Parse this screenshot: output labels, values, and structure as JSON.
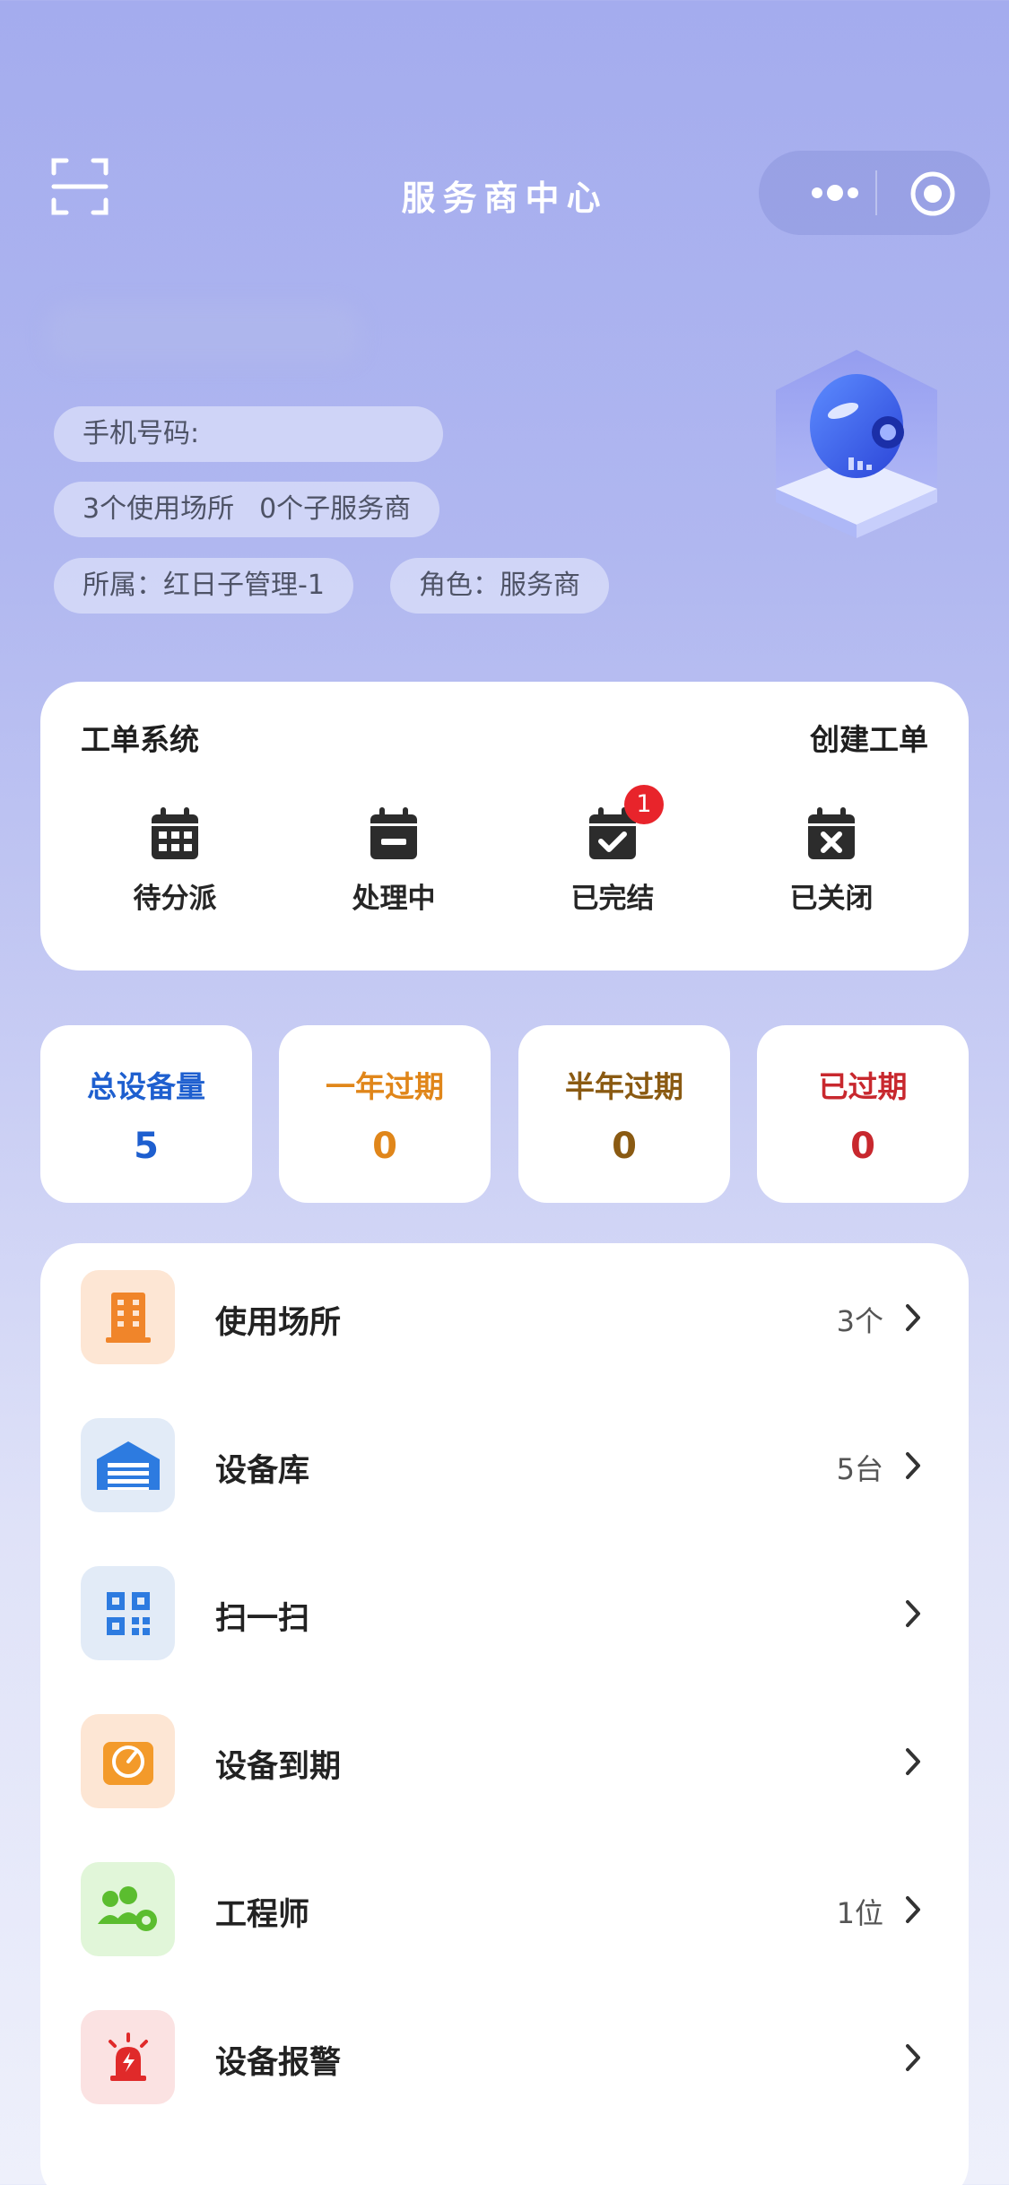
{
  "header": {
    "title": "服务商中心"
  },
  "profile": {
    "phone_label": "手机号码:",
    "venues_count": "3个使用场所",
    "sub_providers_count": "0个子服务商",
    "owner": "所属：红日子管理-1",
    "role": "角色：服务商"
  },
  "work_orders": {
    "title": "工单系统",
    "create_label": "创建工单",
    "items": [
      {
        "label": "待分派"
      },
      {
        "label": "处理中"
      },
      {
        "label": "已完结",
        "badge": "1"
      },
      {
        "label": "已关闭"
      }
    ]
  },
  "stats": [
    {
      "title": "总设备量",
      "value": "5",
      "color": "#1e5fcf"
    },
    {
      "title": "一年过期",
      "value": "0",
      "color": "#e0861a"
    },
    {
      "title": "半年过期",
      "value": "0",
      "color": "#8a5a12"
    },
    {
      "title": "已过期",
      "value": "0",
      "color": "#c8282e"
    }
  ],
  "menu": [
    {
      "name": "使用场所",
      "value": "3个",
      "icon": "building-icon",
      "icon_bg": "#fde6d4",
      "icon_color": "#f0852a"
    },
    {
      "name": "设备库",
      "value": "5台",
      "icon": "warehouse-icon",
      "icon_bg": "#e2ebf7",
      "icon_color": "#2d7be0"
    },
    {
      "name": "扫一扫",
      "value": "",
      "icon": "qr-code-icon",
      "icon_bg": "#e2ebf7",
      "icon_color": "#2d7be0"
    },
    {
      "name": "设备到期",
      "value": "",
      "icon": "gauge-icon",
      "icon_bg": "#fde6d4",
      "icon_color": "#f39a2a"
    },
    {
      "name": "工程师",
      "value": "1位",
      "icon": "engineers-icon",
      "icon_bg": "#e1f6d9",
      "icon_color": "#5bbd2f"
    },
    {
      "name": "设备报警",
      "value": "",
      "icon": "alarm-icon",
      "icon_bg": "#fbe2e2",
      "icon_color": "#e02a2a"
    }
  ]
}
